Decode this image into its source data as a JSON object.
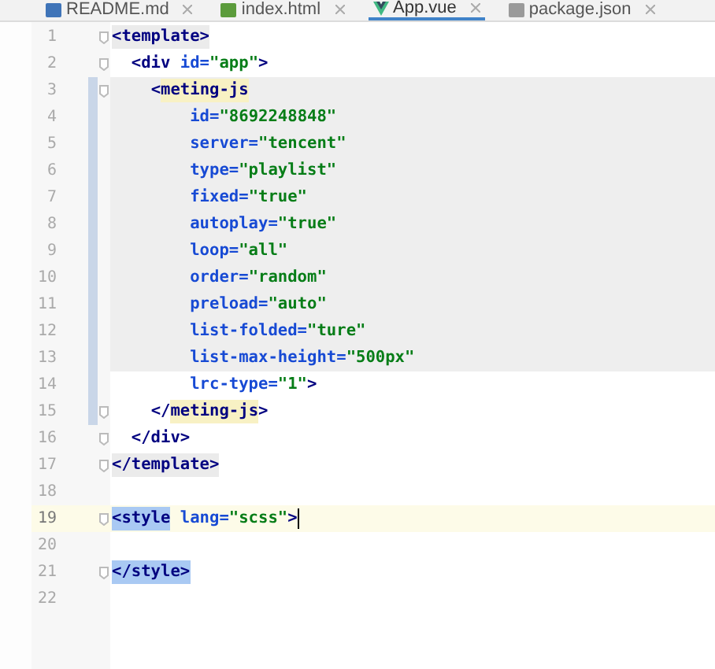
{
  "tabs": [
    {
      "label": "README.md",
      "kind": "md",
      "selected": false
    },
    {
      "label": "index.html",
      "kind": "html",
      "selected": false
    },
    {
      "label": "App.vue",
      "kind": "vue",
      "selected": true
    },
    {
      "label": "package.json",
      "kind": "json",
      "selected": false
    }
  ],
  "lines": [
    {
      "number": "1",
      "fold": true,
      "changed": false,
      "current": false,
      "shaded": false,
      "tokens": [
        {
          "text": "<template>",
          "kind": "tag",
          "color": "#ebebeb"
        }
      ]
    },
    {
      "number": "2",
      "fold": true,
      "changed": false,
      "current": false,
      "shaded": false,
      "tokens": [
        {
          "text": "  <div ",
          "kind": "tag"
        },
        {
          "text": "id=",
          "kind": "attr"
        },
        {
          "text": "\"app\"",
          "kind": "str"
        },
        {
          "text": ">",
          "kind": "tag"
        }
      ]
    },
    {
      "number": "3",
      "fold": true,
      "changed": true,
      "current": false,
      "shaded": true,
      "tokens": [
        {
          "text": "    <",
          "kind": "tag"
        },
        {
          "text": "meting-js",
          "kind": "tag",
          "color": "#f8f1c4"
        }
      ]
    },
    {
      "number": "4",
      "fold": false,
      "changed": true,
      "current": false,
      "shaded": true,
      "tokens": [
        {
          "text": "        id=",
          "kind": "attr"
        },
        {
          "text": "\"8692248848\"",
          "kind": "str"
        }
      ]
    },
    {
      "number": "5",
      "fold": false,
      "changed": true,
      "current": false,
      "shaded": true,
      "tokens": [
        {
          "text": "        server=",
          "kind": "attr"
        },
        {
          "text": "\"tencent\"",
          "kind": "str"
        }
      ]
    },
    {
      "number": "6",
      "fold": false,
      "changed": true,
      "current": false,
      "shaded": true,
      "tokens": [
        {
          "text": "        type=",
          "kind": "attr"
        },
        {
          "text": "\"playlist\"",
          "kind": "str"
        }
      ]
    },
    {
      "number": "7",
      "fold": false,
      "changed": true,
      "current": false,
      "shaded": true,
      "tokens": [
        {
          "text": "        fixed=",
          "kind": "attr"
        },
        {
          "text": "\"true\"",
          "kind": "str"
        }
      ]
    },
    {
      "number": "8",
      "fold": false,
      "changed": true,
      "current": false,
      "shaded": true,
      "tokens": [
        {
          "text": "        autoplay=",
          "kind": "attr"
        },
        {
          "text": "\"true\"",
          "kind": "str"
        }
      ]
    },
    {
      "number": "9",
      "fold": false,
      "changed": true,
      "current": false,
      "shaded": true,
      "tokens": [
        {
          "text": "        loop=",
          "kind": "attr"
        },
        {
          "text": "\"all\"",
          "kind": "str"
        }
      ]
    },
    {
      "number": "10",
      "fold": false,
      "changed": true,
      "current": false,
      "shaded": true,
      "tokens": [
        {
          "text": "        order=",
          "kind": "attr"
        },
        {
          "text": "\"random\"",
          "kind": "str"
        }
      ]
    },
    {
      "number": "11",
      "fold": false,
      "changed": true,
      "current": false,
      "shaded": true,
      "tokens": [
        {
          "text": "        preload=",
          "kind": "attr"
        },
        {
          "text": "\"auto\"",
          "kind": "str"
        }
      ]
    },
    {
      "number": "12",
      "fold": false,
      "changed": true,
      "current": false,
      "shaded": true,
      "tokens": [
        {
          "text": "        list-folded=",
          "kind": "attr"
        },
        {
          "text": "\"ture\"",
          "kind": "str"
        }
      ]
    },
    {
      "number": "13",
      "fold": false,
      "changed": true,
      "current": false,
      "shaded": true,
      "tokens": [
        {
          "text": "        list-max-height=",
          "kind": "attr"
        },
        {
          "text": "\"500px\"",
          "kind": "str"
        }
      ]
    },
    {
      "number": "14",
      "fold": false,
      "changed": true,
      "current": false,
      "shaded": false,
      "tokens": [
        {
          "text": "        lrc-type=",
          "kind": "attr"
        },
        {
          "text": "\"1\"",
          "kind": "str"
        },
        {
          "text": ">",
          "kind": "tag"
        }
      ]
    },
    {
      "number": "15",
      "fold": true,
      "changed": true,
      "current": false,
      "shaded": false,
      "tokens": [
        {
          "text": "    </",
          "kind": "tag"
        },
        {
          "text": "meting-js",
          "kind": "tag",
          "color": "#f8f1c4"
        },
        {
          "text": ">",
          "kind": "tag"
        }
      ]
    },
    {
      "number": "16",
      "fold": true,
      "changed": false,
      "current": false,
      "shaded": false,
      "tokens": [
        {
          "text": "  </div>",
          "kind": "tag"
        }
      ]
    },
    {
      "number": "17",
      "fold": true,
      "changed": false,
      "current": false,
      "shaded": false,
      "tokens": [
        {
          "text": "</template>",
          "kind": "tag",
          "color": "#ebebeb"
        }
      ]
    },
    {
      "number": "18",
      "fold": false,
      "changed": false,
      "current": false,
      "shaded": false
    },
    {
      "number": "19",
      "fold": true,
      "changed": false,
      "current": true,
      "shaded": false,
      "tokens": [
        {
          "text": "<style",
          "kind": "tag",
          "color": "#a9c9f3"
        },
        {
          "text": " lang=",
          "kind": "attr"
        },
        {
          "text": "\"scss\"",
          "kind": "str"
        },
        {
          "text": ">",
          "kind": "tag"
        }
      ]
    },
    {
      "number": "20",
      "fold": false,
      "changed": false,
      "current": false,
      "shaded": false
    },
    {
      "number": "21",
      "fold": true,
      "changed": false,
      "current": false,
      "shaded": false,
      "tokens": [
        {
          "text": "</style>",
          "kind": "tag",
          "color": "#a9c9f3"
        }
      ]
    },
    {
      "number": "22",
      "fold": false,
      "changed": false,
      "current": false,
      "shaded": false
    }
  ]
}
